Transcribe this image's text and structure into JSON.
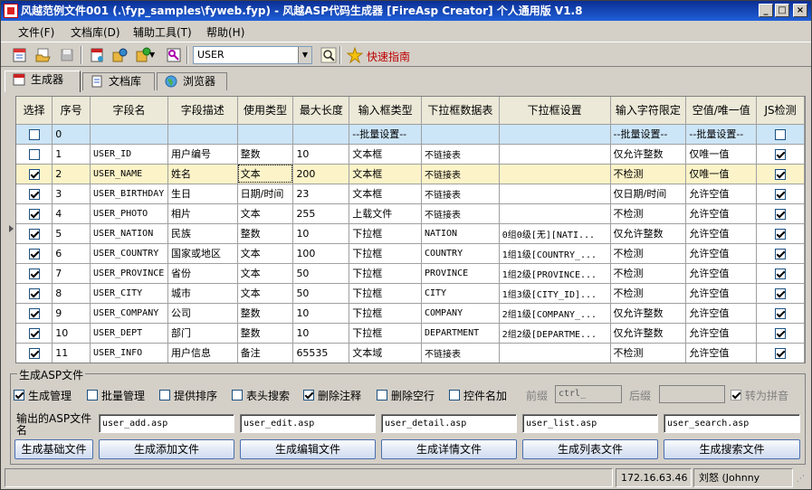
{
  "window": {
    "title": "风越范例文件001 (.\\fyp_samples\\fyweb.fyp) - 风越ASP代码生成器 [FireAsp Creator] 个人通用版 V1.8",
    "controls": [
      "_",
      "□",
      "×"
    ]
  },
  "menu": [
    "文件(F)",
    "文档库(D)",
    "辅助工具(T)",
    "帮助(H)"
  ],
  "toolbar": {
    "combo_value": "USER",
    "quick_guide": "快速指南"
  },
  "tabs": [
    "生成器",
    "文档库",
    "浏览器"
  ],
  "grid": {
    "headers": [
      "选择",
      "序号",
      "字段名",
      "字段描述",
      "使用类型",
      "最大长度",
      "输入框类型",
      "下拉框数据表",
      "下拉框设置",
      "输入字符限定",
      "空值/唯一值",
      "JS检测"
    ],
    "batch_row": {
      "no": "0",
      "input_type": "--批量设置--",
      "char_limit": "--批量设置--",
      "null_unique": "--批量设置--"
    },
    "rows": [
      {
        "checked": false,
        "no": "1",
        "field": "USER_ID",
        "desc": "用户编号",
        "type": "整数",
        "maxlen": "10",
        "input": "文本框",
        "ddtable": "不链接表",
        "ddset": "",
        "limit": "仅允许整数",
        "nullu": "仅唯一值",
        "js": true
      },
      {
        "checked": true,
        "no": "2",
        "field": "USER_NAME",
        "desc": "姓名",
        "type": "文本",
        "maxlen": "200",
        "input": "文本框",
        "ddtable": "不链接表",
        "ddset": "",
        "limit": "不检测",
        "nullu": "仅唯一值",
        "js": true
      },
      {
        "checked": true,
        "no": "3",
        "field": "USER_BIRTHDAY",
        "desc": "生日",
        "type": "日期/时间",
        "maxlen": "23",
        "input": "文本框",
        "ddtable": "不链接表",
        "ddset": "",
        "limit": "仅日期/时间",
        "nullu": "允许空值",
        "js": true
      },
      {
        "checked": true,
        "no": "4",
        "field": "USER_PHOTO",
        "desc": "相片",
        "type": "文本",
        "maxlen": "255",
        "input": "上载文件",
        "ddtable": "不链接表",
        "ddset": "",
        "limit": "不检测",
        "nullu": "允许空值",
        "js": true
      },
      {
        "checked": true,
        "no": "5",
        "field": "USER_NATION",
        "desc": "民族",
        "type": "整数",
        "maxlen": "10",
        "input": "下拉框",
        "ddtable": "NATION",
        "ddset": "0组0级[无][NATI...",
        "limit": "仅允许整数",
        "nullu": "允许空值",
        "js": true
      },
      {
        "checked": true,
        "no": "6",
        "field": "USER_COUNTRY",
        "desc": "国家或地区",
        "type": "文本",
        "maxlen": "100",
        "input": "下拉框",
        "ddtable": "COUNTRY",
        "ddset": "1组1级[COUNTRY_...",
        "limit": "不检测",
        "nullu": "允许空值",
        "js": true
      },
      {
        "checked": true,
        "no": "7",
        "field": "USER_PROVINCE",
        "desc": "省份",
        "type": "文本",
        "maxlen": "50",
        "input": "下拉框",
        "ddtable": "PROVINCE",
        "ddset": "1组2级[PROVINCE...",
        "limit": "不检测",
        "nullu": "允许空值",
        "js": true
      },
      {
        "checked": true,
        "no": "8",
        "field": "USER_CITY",
        "desc": "城市",
        "type": "文本",
        "maxlen": "50",
        "input": "下拉框",
        "ddtable": "CITY",
        "ddset": "1组3级[CITY_ID]...",
        "limit": "不检测",
        "nullu": "允许空值",
        "js": true
      },
      {
        "checked": true,
        "no": "9",
        "field": "USER_COMPANY",
        "desc": "公司",
        "type": "整数",
        "maxlen": "10",
        "input": "下拉框",
        "ddtable": "COMPANY",
        "ddset": "2组1级[COMPANY_...",
        "limit": "仅允许整数",
        "nullu": "允许空值",
        "js": true
      },
      {
        "checked": true,
        "no": "10",
        "field": "USER_DEPT",
        "desc": "部门",
        "type": "整数",
        "maxlen": "10",
        "input": "下拉框",
        "ddtable": "DEPARTMENT",
        "ddset": "2组2级[DEPARTME...",
        "limit": "仅允许整数",
        "nullu": "允许空值",
        "js": true
      },
      {
        "checked": true,
        "no": "11",
        "field": "USER_INFO",
        "desc": "用户信息",
        "type": "备注",
        "maxlen": "65535",
        "input": "文本域",
        "ddtable": "不链接表",
        "ddset": "",
        "limit": "不检测",
        "nullu": "允许空值",
        "js": true
      }
    ]
  },
  "gen": {
    "group_title": "生成ASP文件",
    "options": [
      {
        "label": "生成管理",
        "checked": true
      },
      {
        "label": "批量管理",
        "checked": false
      },
      {
        "label": "提供排序",
        "checked": false
      },
      {
        "label": "表头搜索",
        "checked": false
      },
      {
        "label": "删除注释",
        "checked": true
      },
      {
        "label": "删除空行",
        "checked": false
      },
      {
        "label": "控件名加",
        "checked": false
      }
    ],
    "prefix_label": "前缀",
    "prefix_value": "ctrl_",
    "suffix_label": "后缀",
    "suffix_value": "",
    "pinyin_label": "转为拼音",
    "output_label": "输出的ASP文件名",
    "files": [
      "user_add.asp",
      "user_edit.asp",
      "user_detail.asp",
      "user_list.asp",
      "user_search.asp"
    ],
    "buttons": [
      "生成基础文件",
      "生成添加文件",
      "生成编辑文件",
      "生成详情文件",
      "生成列表文件",
      "生成搜索文件"
    ]
  },
  "status": {
    "main": "",
    "ip": "172.16.63.46",
    "user": "刘怒 (Johnny LiuNu)"
  }
}
